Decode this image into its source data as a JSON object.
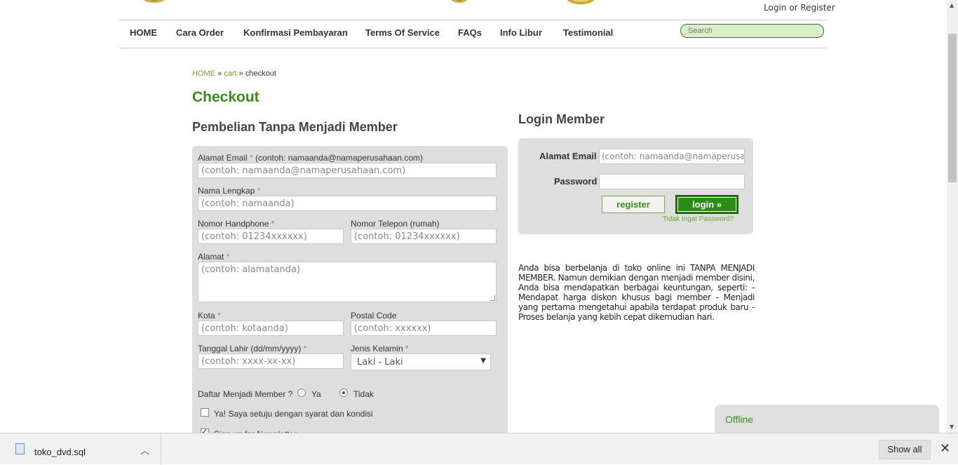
{
  "header": {
    "login_text": "Login",
    "or_text": "or",
    "register_text": "Register"
  },
  "nav": {
    "items": [
      "HOME",
      "Cara Order",
      "Konfirmasi Pembayaran",
      "Terms Of Service",
      "FAQs",
      "Info Libur",
      "Testimonial"
    ],
    "search_placeholder": "Search"
  },
  "breadcrumb": {
    "home": "HOME",
    "sep": "»",
    "cart": "cart",
    "current": "checkout"
  },
  "page": {
    "title": "Checkout",
    "guest_heading": "Pembelian Tanpa Menjadi Member",
    "login_heading": "Login Member"
  },
  "form": {
    "email_label": "Alamat Email",
    "email_hint": "(contoh: namaanda@namaperusahaan.com)",
    "email_placeholder": "(contoh: namaanda@namaperusahaan.com)",
    "name_label": "Nama Lengkap",
    "name_placeholder": "(contoh: namaanda)",
    "hp_label": "Nomor Handphone",
    "hp_placeholder": "(contoh: 01234xxxxxx)",
    "tel_label": "Nomor Telepon (rumah)",
    "tel_placeholder": "(contoh: 01234xxxxxx)",
    "address_label": "Alamat",
    "address_placeholder": "(contoh: alamatanda)",
    "city_label": "Kota",
    "city_placeholder": "(contoh: kotaanda)",
    "postal_label": "Postal Code",
    "postal_placeholder": "(contoh: xxxxxx)",
    "dob_label": "Tanggal Lahir (dd/mm/yyyy)",
    "dob_placeholder": "(contoh: xxxx-xx-xx)",
    "gender_label": "Jenis Kelamin",
    "gender_value": "Laki - Laki",
    "member_question": "Daftar Menjadi Member ?",
    "yes_label": "Ya",
    "no_label": "Tidak",
    "agree_label": "Ya! Saya setuju dengan syarat dan kondisi",
    "newsletter_label": "Sign up for Newsletter",
    "required_mark": "*"
  },
  "login": {
    "email_label": "Alamat Email",
    "email_placeholder": "(contoh: namaanda@namaperusahaan.com)",
    "password_label": "Password",
    "register_button": "register",
    "login_button": "login »",
    "forgot_link": "Tidak Ingat Password?"
  },
  "member_info": "Anda bisa berbelanja di toko online ini TANPA MENJADI MEMBER. Namun demikian dengan menjadi member disini, Anda bisa mendapatkan berbagai keuntungan, seperti: - Mendapat harga diskon khusus bagi member - Menjadi yang pertama mengetahui apabila terdapat produk baru - Proses belanja yang kebih cepat dikemudian hari.",
  "chat": {
    "status": "Offline"
  },
  "download_bar": {
    "file_name": "toko_dvd.sql",
    "show_all": "Show all"
  },
  "colors": {
    "accent_green": "#3a8e17",
    "link_green": "#6aa92a",
    "panel_gray": "#dedede"
  }
}
